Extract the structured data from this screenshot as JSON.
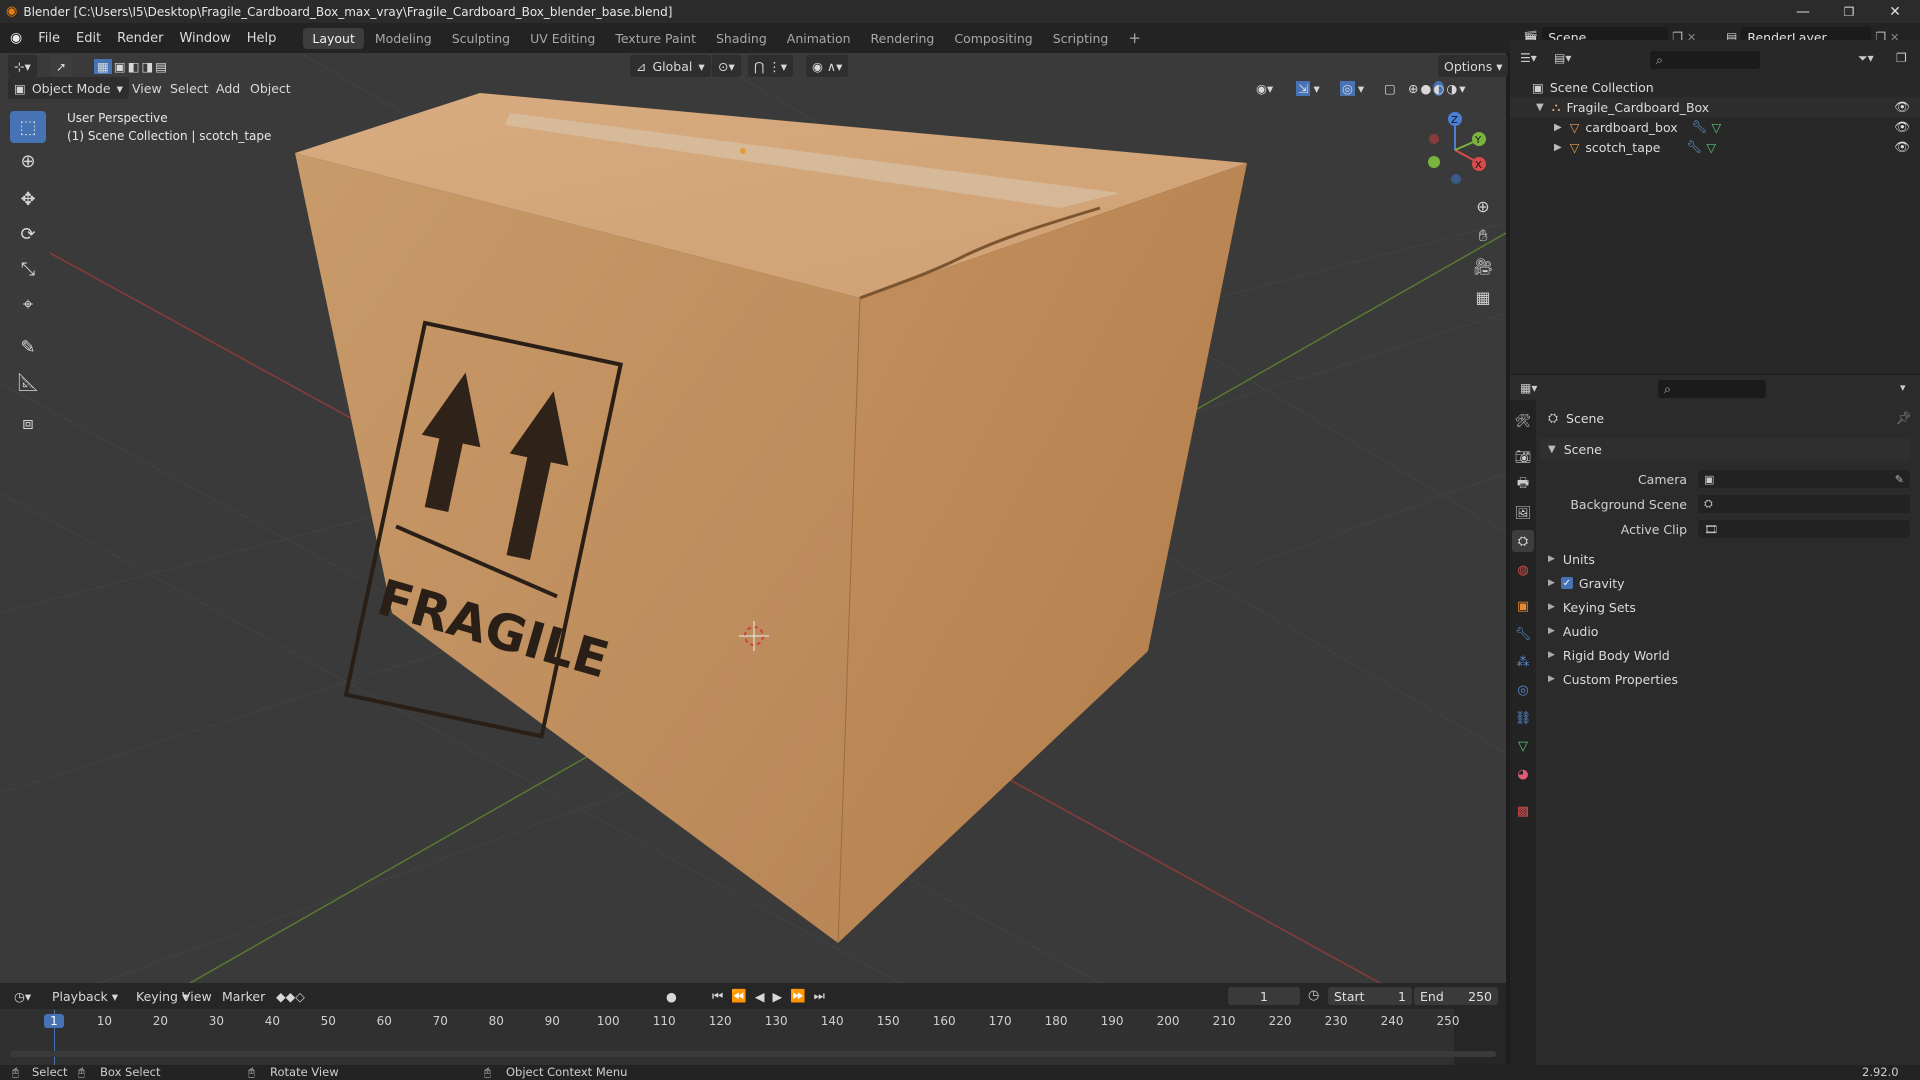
{
  "window": {
    "title": "Blender [C:\\Users\\I5\\Desktop\\Fragile_Cardboard_Box_max_vray\\Fragile_Cardboard_Box_blender_base.blend]",
    "controls": [
      "—",
      "❐",
      "✕"
    ]
  },
  "menu": [
    "File",
    "Edit",
    "Render",
    "Window",
    "Help"
  ],
  "workspaces": {
    "active": "Layout",
    "tabs": [
      "Layout",
      "Modeling",
      "Sculpting",
      "UV Editing",
      "Texture Paint",
      "Shading",
      "Animation",
      "Rendering",
      "Compositing",
      "Scripting"
    ],
    "add": "+"
  },
  "scene_selector": {
    "scene": "Scene",
    "view_layer": "RenderLayer"
  },
  "viewport": {
    "transform_orientation": "Global",
    "options_label": "Options",
    "mode": "Object Mode",
    "header_menus": [
      "View",
      "Select",
      "Add",
      "Object"
    ],
    "overlay_title": "User Perspective",
    "overlay_subtitle": "(1) Scene Collection | scotch_tape",
    "box_label": "FRAGILE",
    "gizmo_axes": [
      "X",
      "Y",
      "Z"
    ]
  },
  "outliner": {
    "root": "Scene Collection",
    "collection": "Fragile_Cardboard_Box",
    "objects": [
      "cardboard_box",
      "scotch_tape"
    ]
  },
  "properties": {
    "context_title": "Scene",
    "panel_title": "Scene",
    "fields": [
      {
        "label": "Camera",
        "value": ""
      },
      {
        "label": "Background Scene",
        "value": ""
      },
      {
        "label": "Active Clip",
        "value": ""
      }
    ],
    "subpanels": [
      "Units",
      "Gravity",
      "Keying Sets",
      "Audio",
      "Rigid Body World",
      "Custom Properties"
    ],
    "gravity_checked": true
  },
  "timeline": {
    "menus": [
      "Playback",
      "Keying",
      "View",
      "Marker"
    ],
    "current_frame": "1",
    "start_label": "Start",
    "start": "1",
    "end_label": "End",
    "end": "250",
    "ticks": [
      "1",
      "10",
      "20",
      "30",
      "40",
      "50",
      "60",
      "70",
      "80",
      "90",
      "100",
      "110",
      "120",
      "130",
      "140",
      "150",
      "160",
      "170",
      "180",
      "190",
      "200",
      "210",
      "220",
      "230",
      "240",
      "250"
    ]
  },
  "statusbar": {
    "select": "Select",
    "box_select": "Box Select",
    "rotate_view": "Rotate View",
    "context_menu": "Object Context Menu",
    "version": "2.92.0"
  },
  "colors": {
    "accent": "#4772b3",
    "cardboard": "#c89866",
    "axis_x": "#d84a4a",
    "axis_y": "#7ab33e",
    "axis_z": "#4a7fd8"
  }
}
